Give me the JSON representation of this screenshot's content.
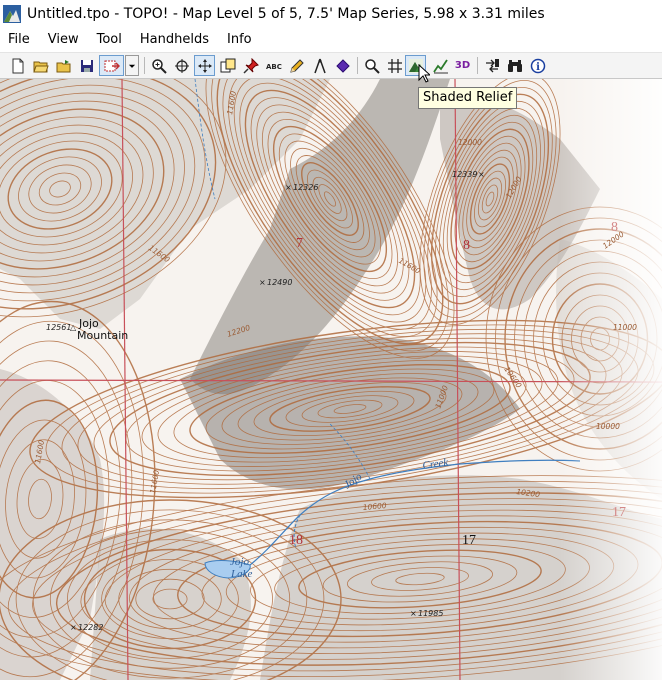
{
  "window": {
    "title": "Untitled.tpo - TOPO! - Map Level 5 of 5, 7.5' Map Series, 5.98 x 3.31 miles"
  },
  "menu": [
    "File",
    "View",
    "Tool",
    "Handhelds",
    "Info"
  ],
  "toolbar": {
    "buttons": [
      "new-file",
      "open-file",
      "open-folder",
      "save",
      "export",
      "export-dropdown",
      "zoom-in",
      "center-target",
      "pan",
      "copy",
      "pushpin",
      "text-label",
      "pencil",
      "compass",
      "diamond-marker",
      "search",
      "grid",
      "shaded-relief",
      "profile",
      "3d-view",
      "gps-transfer",
      "binoculars",
      "info"
    ],
    "three_d_label": "3D",
    "tooltip": "Shaded Relief"
  },
  "map": {
    "section_numbers": [
      "7",
      "8",
      "8",
      "18",
      "17",
      "17"
    ],
    "peak_labels": [
      "12326",
      "12339",
      "12490",
      "12561",
      "12282",
      "11985"
    ],
    "contour_labels": [
      "11600",
      "12000",
      "12000",
      "11600",
      "12200",
      "12000",
      "11600",
      "10600",
      "10600",
      "10200",
      "11000",
      "10000",
      "11600",
      "11600",
      "11000"
    ],
    "place_names": {
      "mountain": [
        "Jojo",
        "Mountain"
      ],
      "creek": [
        "Jojo",
        "Creek"
      ],
      "lake": [
        "Jojo",
        "Lake"
      ]
    },
    "colors": {
      "contour": "#b06a3c",
      "section_line": "#c8505a",
      "water": "#3f7fc0",
      "shade": "#8c8c8c"
    }
  }
}
